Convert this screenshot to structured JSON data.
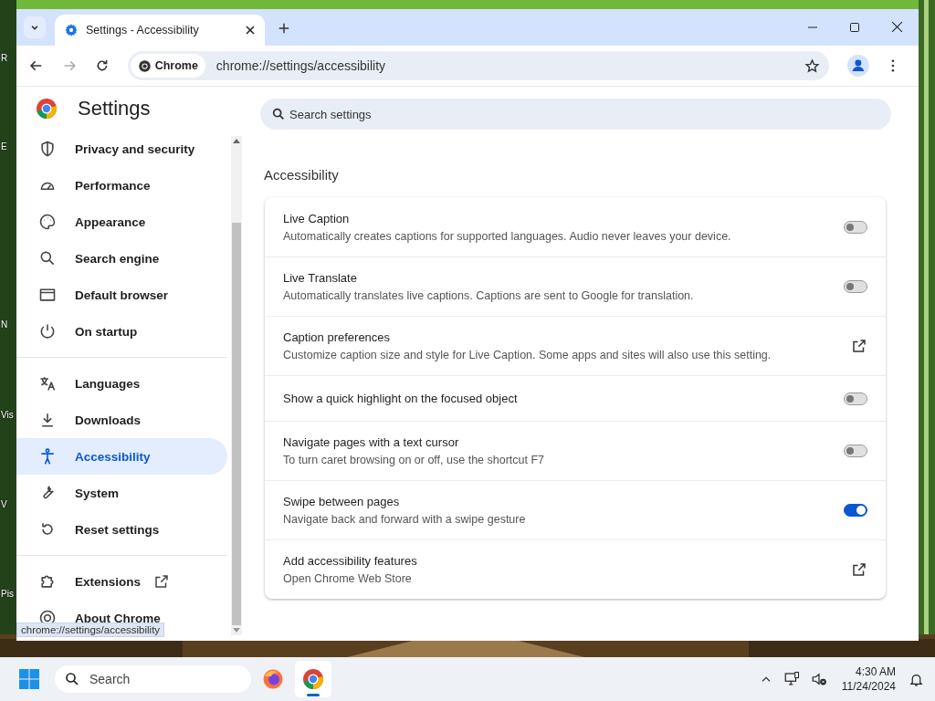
{
  "desktop": {
    "icon_labels": [
      "R",
      "E",
      "N",
      "Vis",
      "V",
      "Pis"
    ]
  },
  "browser": {
    "tabs": [
      {
        "title": "Settings - Accessibility",
        "selected": true
      }
    ],
    "address_bar": {
      "chip": "Chrome",
      "url": "chrome://settings/accessibility"
    }
  },
  "sidebar": {
    "title": "Settings",
    "sections": [
      {
        "items": [
          {
            "label": "Privacy and security",
            "selected": false,
            "opens_externally": false
          },
          {
            "label": "Performance",
            "selected": false,
            "opens_externally": false
          },
          {
            "label": "Appearance",
            "selected": false,
            "opens_externally": false
          },
          {
            "label": "Search engine",
            "selected": false,
            "opens_externally": false
          },
          {
            "label": "Default browser",
            "selected": false,
            "opens_externally": false
          },
          {
            "label": "On startup",
            "selected": false,
            "opens_externally": false
          }
        ]
      },
      {
        "items": [
          {
            "label": "Languages",
            "selected": false,
            "opens_externally": false
          },
          {
            "label": "Downloads",
            "selected": false,
            "opens_externally": false
          },
          {
            "label": "Accessibility",
            "selected": true,
            "opens_externally": false
          },
          {
            "label": "System",
            "selected": false,
            "opens_externally": false
          },
          {
            "label": "Reset settings",
            "selected": false,
            "opens_externally": false
          }
        ]
      },
      {
        "items": [
          {
            "label": "Extensions",
            "selected": false,
            "opens_externally": true
          },
          {
            "label": "About Chrome",
            "selected": false,
            "opens_externally": false
          }
        ]
      }
    ]
  },
  "status_bubble": "chrome://settings/accessibility",
  "main": {
    "search": {
      "placeholder": "Search settings"
    },
    "section_title": "Accessibility",
    "rows": [
      {
        "kind": "toggle",
        "title": "Live Caption",
        "description": "Automatically creates captions for supported languages. Audio never leaves your device.",
        "on": false
      },
      {
        "kind": "toggle",
        "title": "Live Translate",
        "description": "Automatically translates live captions. Captions are sent to Google for translation.",
        "on": false
      },
      {
        "kind": "link",
        "title": "Caption preferences",
        "description": "Customize caption size and style for Live Caption. Some apps and sites will also use this setting."
      },
      {
        "kind": "toggle",
        "title": "Show a quick highlight on the focused object",
        "on": false
      },
      {
        "kind": "toggle",
        "title": "Navigate pages with a text cursor",
        "description": "To turn caret browsing on or off, use the shortcut F7",
        "on": false
      },
      {
        "kind": "toggle",
        "title": "Swipe between pages",
        "description": "Navigate back and forward with a swipe gesture",
        "on": true
      },
      {
        "kind": "link",
        "title": "Add accessibility features",
        "description": "Open Chrome Web Store"
      }
    ]
  },
  "taskbar": {
    "search": {
      "placeholder": "Search"
    },
    "apps": [
      {
        "selected": false
      },
      {
        "selected": true
      }
    ],
    "clock": {
      "time": "4:30 AM",
      "date": "11/24/2024"
    }
  }
}
